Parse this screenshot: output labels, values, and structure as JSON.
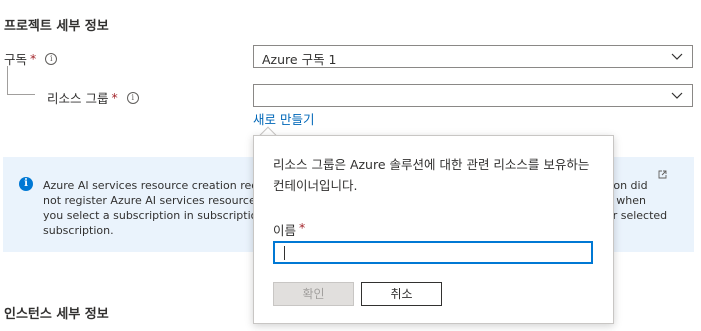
{
  "sections": {
    "project_details": "프로젝트 세부 정보",
    "instance_details": "인스턴스 세부 정보"
  },
  "subscription": {
    "label": "구독",
    "required_mark": "*",
    "info": "i",
    "value": "Azure 구독 1"
  },
  "resource_group": {
    "label": "리소스 그룹",
    "required_mark": "*",
    "info": "i",
    "value": "",
    "create_new_link": "새로 만들기"
  },
  "info_banner": {
    "icon": "i",
    "text_left": "Azure AI services resource creation requ\nnot register Azure AI services resource t\nyou select a subscription in subscription\nsubscription.",
    "text_right": "ption did\nbe when\nour selected",
    "external_link_icon": "external-link-icon"
  },
  "popup": {
    "description": "리소스 그룹은 Azure 솔루션에 대한 관련 리소스를 보유하는 컨테이너입니다.",
    "name_label": "이름",
    "required_mark": "*",
    "name_value": "",
    "ok_label": "확인",
    "cancel_label": "취소"
  },
  "colors": {
    "link": "#0067b8",
    "required": "#a4262c",
    "accent": "#0078d4",
    "banner_bg": "#eaf3fc"
  }
}
